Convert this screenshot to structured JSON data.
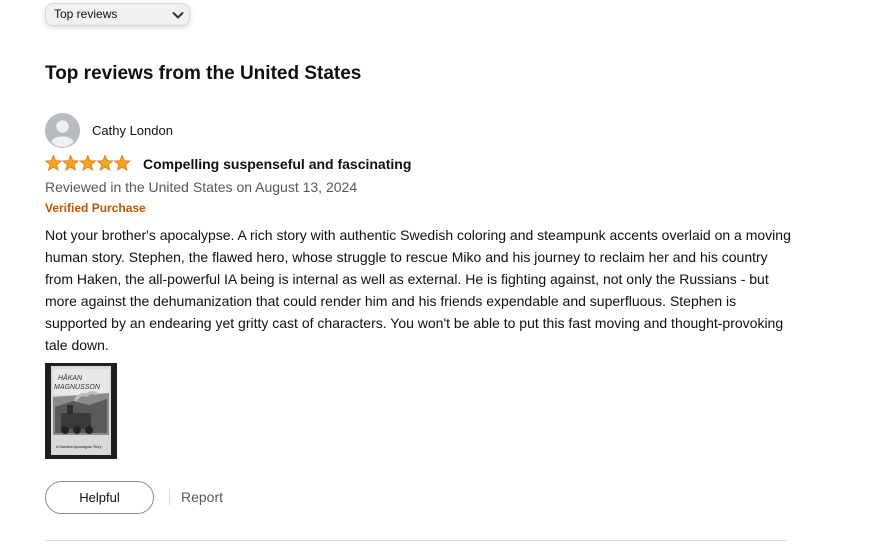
{
  "sort": {
    "selected": "Top reviews",
    "icon": "chevron-down-icon"
  },
  "section_title": "Top reviews from the United States",
  "review": {
    "reviewer": {
      "name": "Cathy London",
      "avatar_icon": "user-avatar-icon"
    },
    "rating": 5,
    "rating_max": 5,
    "title": "Compelling suspenseful and fascinating",
    "date_line": "Reviewed in the United States on August 13, 2024",
    "badge": "Verified Purchase",
    "body": "Not your brother's apocalypse. A rich story with authentic Swedish coloring and steampunk accents overlaid on a moving human story. Stephen, the flawed hero, whose struggle to rescue Miko and his journey to reclaim her and his country from Haken, the all-powerful IA being is internal as well as external. He is fighting against, not only the Russians - but more against the dehumanization that could render him and his friends expendable and superfluous. Stephen is supported by an endearing yet gritty cast of characters. You won't be able to put this fast moving and thought-provoking tale down.",
    "image": {
      "author_line1": "HÅKAN",
      "author_line2": "MAGNUSSON",
      "subtitle": "A Swedish Apocalypse Story"
    },
    "helpful_label": "Helpful",
    "report_label": "Report"
  },
  "colors": {
    "star": "#f4a41c",
    "verified": "#c45500",
    "muted_text": "#565959",
    "border": "#d5d9d9"
  }
}
